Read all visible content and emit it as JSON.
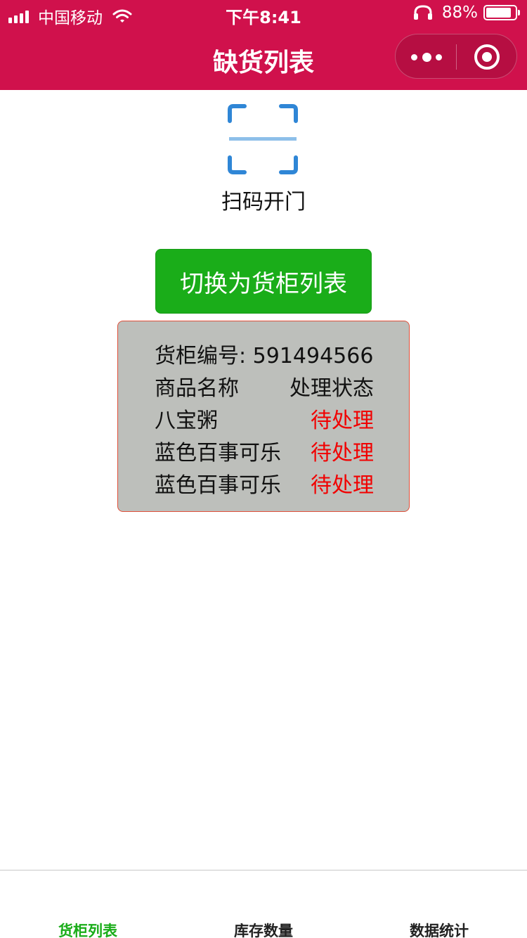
{
  "status_bar": {
    "carrier": "中国移动",
    "time": "下午8:41",
    "battery_percent": "88%",
    "battery_level": 0.88
  },
  "nav": {
    "title": "缺货列表",
    "more_icon": "more-dots-icon",
    "close_icon": "target-circle-icon"
  },
  "scan": {
    "icon": "scan-qr-icon",
    "label": "扫码开门"
  },
  "switch_button": {
    "label": "切换为货柜列表",
    "color": "#1aad19"
  },
  "card": {
    "cabinet_label": "货柜编号: 591494566",
    "header": {
      "name": "商品名称",
      "status": "处理状态"
    },
    "items": [
      {
        "name": "八宝粥",
        "status": "待处理"
      },
      {
        "name": "蓝色百事可乐",
        "status": "待处理"
      },
      {
        "name": "蓝色百事可乐",
        "status": "待处理"
      }
    ]
  },
  "tabbar": {
    "tabs": [
      {
        "label": "货柜列表",
        "active": true
      },
      {
        "label": "库存数量",
        "active": false
      },
      {
        "label": "数据统计",
        "active": false
      }
    ]
  },
  "colors": {
    "brand": "#d0114c",
    "pending": "#f10000",
    "active_tab": "#1aad19"
  }
}
